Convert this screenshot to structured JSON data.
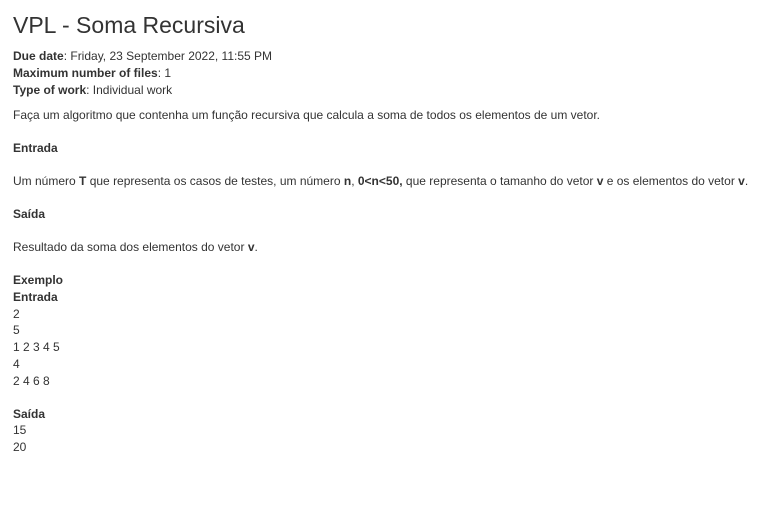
{
  "title": "VPL - Soma Recursiva",
  "meta": {
    "due_date_label": "Due date",
    "due_date_value": "Friday, 23 September 2022, 11:55 PM",
    "max_files_label": "Maximum number of files",
    "max_files_value": "1",
    "type_label": "Type of work",
    "type_value": "Individual work"
  },
  "description": "Faça um algoritmo que contenha um função recursiva que calcula a soma de todos os elementos de um vetor.",
  "entrada": {
    "heading": "Entrada",
    "text_1": "Um  número ",
    "T": "T",
    "text_2": " que representa os casos de testes, um  número ",
    "n": "n",
    "text_3": ", ",
    "cond": "0<n<50,",
    "text_4": " que representa o tamanho do vetor ",
    "v1": "v",
    "text_5": " e os elementos do vetor ",
    "v2": "v",
    "text_6": "."
  },
  "saida": {
    "heading": "Saída",
    "text_1": "Resultado da soma dos elementos do vetor ",
    "v": "v",
    "text_2": "."
  },
  "exemplo": {
    "heading": "Exemplo",
    "entrada_heading": "Entrada",
    "entrada_lines": [
      "2",
      "5",
      "1 2 3 4 5",
      "4",
      "2 4 6 8"
    ],
    "saida_heading": "Saída",
    "saida_lines": [
      "15",
      "20"
    ]
  }
}
